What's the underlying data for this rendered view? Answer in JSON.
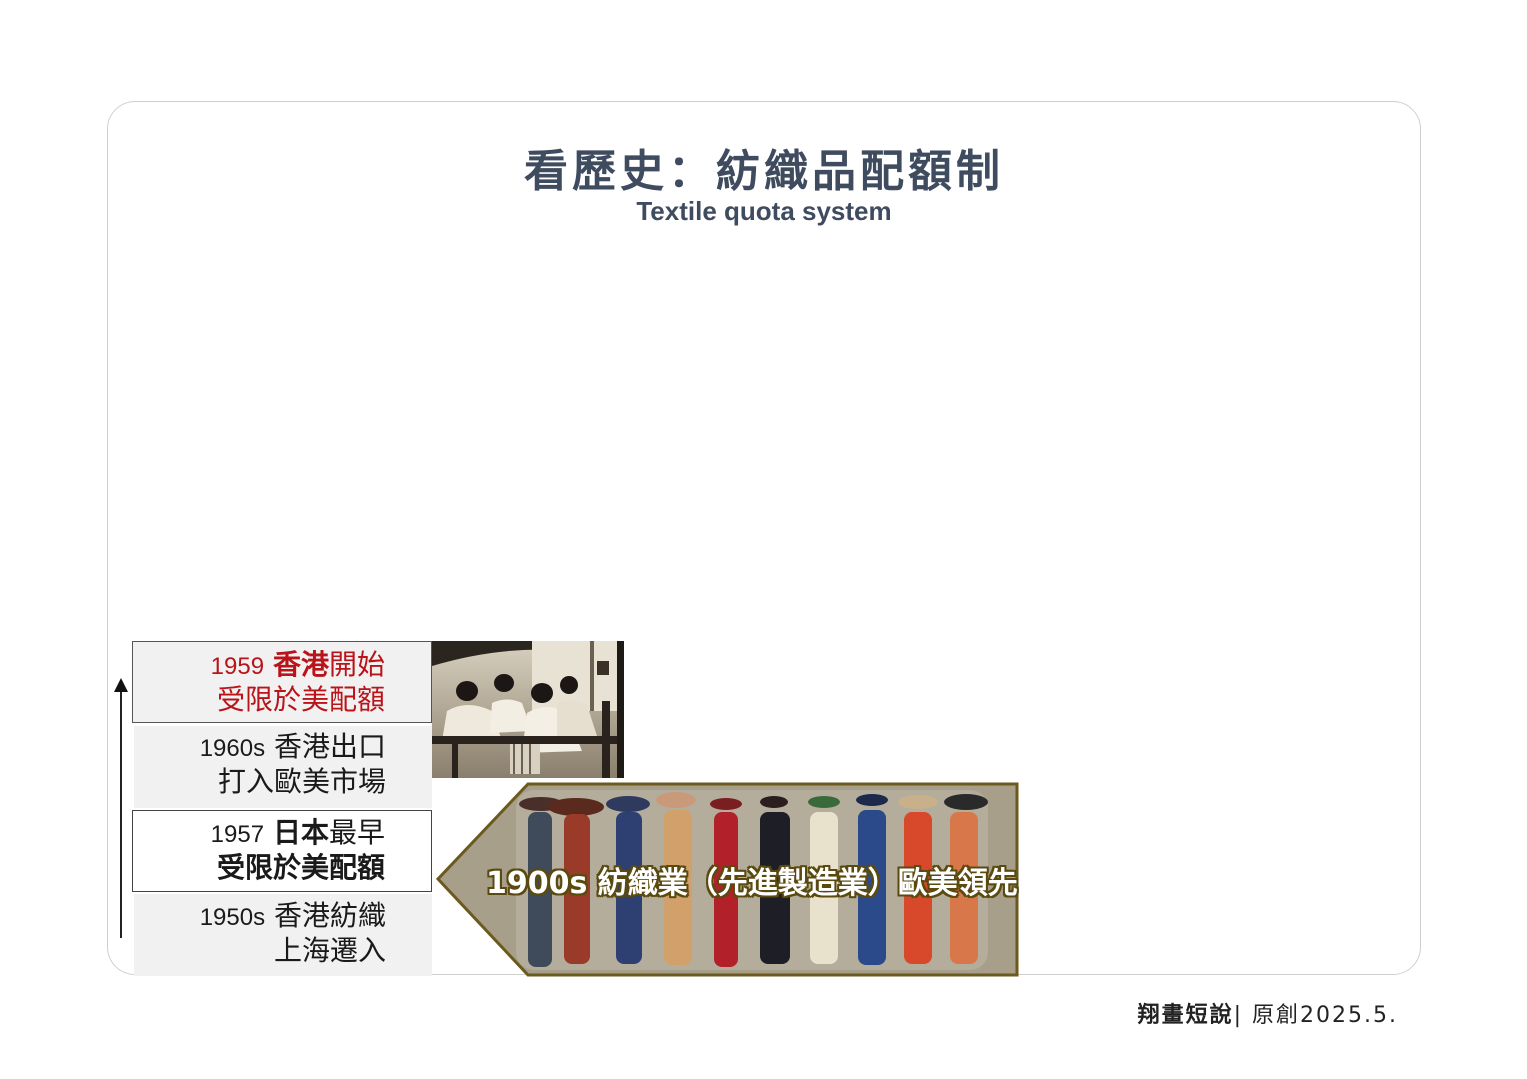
{
  "header": {
    "title": "看歷史：紡織品配額制",
    "subtitle": "Textile quota system"
  },
  "timeline": [
    {
      "year": "1959",
      "line1_bold": "香港",
      "line1_rest": "開始",
      "line2": "受限於美配額",
      "color": "#b8141a"
    },
    {
      "year": "1960s",
      "line1_rest": "香港出口",
      "line2": "打入歐美市場",
      "color": "#1a1a1a"
    },
    {
      "year": "1957",
      "line1_bold": "日本",
      "line1_rest": "最早",
      "line2": "受限於美配額",
      "color": "#1a1a1a"
    },
    {
      "year": "1950s",
      "line1_rest": "香港紡織",
      "line2": "上海遷入",
      "color": "#1a1a1a"
    }
  ],
  "banner": {
    "text": "1900s 紡織業（先進製造業）歐美領先",
    "border_color": "#6b5a1e"
  },
  "footer": {
    "brand": "翔畫短說",
    "separator": "|",
    "credit": "原創2025.5."
  }
}
